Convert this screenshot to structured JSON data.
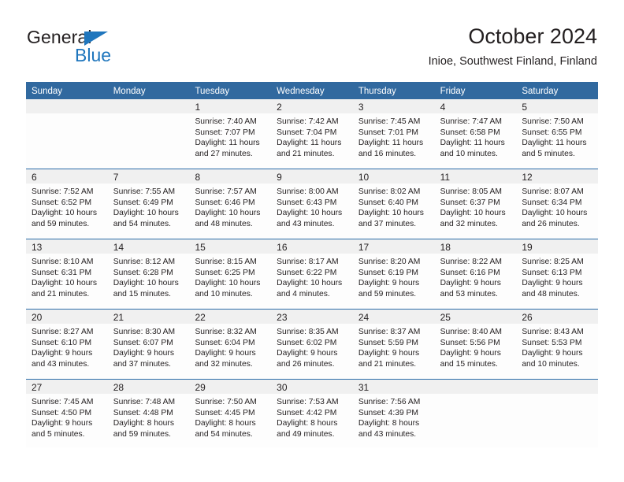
{
  "brand": {
    "name_part1": "General",
    "name_part2": "Blue",
    "triangle_icon": "blue-triangle-logo-mark",
    "color_dark": "#231f20",
    "color_blue": "#1f76bd"
  },
  "header": {
    "title": "October 2024",
    "subtitle": "Inioe, Southwest Finland, Finland"
  },
  "theme": {
    "header_row_bg": "#31699f",
    "header_row_text": "#ffffff",
    "day_band_bg": "#f0f0f0",
    "row_divider": "#2b6ca8",
    "cell_bg": "#fdfdfd",
    "text": "#231f20"
  },
  "weekdays": [
    "Sunday",
    "Monday",
    "Tuesday",
    "Wednesday",
    "Thursday",
    "Friday",
    "Saturday"
  ],
  "labels": {
    "sunrise_prefix": "Sunrise:",
    "sunset_prefix": "Sunset:",
    "daylight_prefix": "Daylight:"
  },
  "weeks": [
    [
      {
        "day": "",
        "empty": true,
        "sunrise": "",
        "sunset": "",
        "daylight_line1": "",
        "daylight_line2": ""
      },
      {
        "day": "",
        "empty": true,
        "sunrise": "",
        "sunset": "",
        "daylight_line1": "",
        "daylight_line2": ""
      },
      {
        "day": "1",
        "empty": false,
        "sunrise": "Sunrise: 7:40 AM",
        "sunset": "Sunset: 7:07 PM",
        "daylight_line1": "Daylight: 11 hours",
        "daylight_line2": "and 27 minutes."
      },
      {
        "day": "2",
        "empty": false,
        "sunrise": "Sunrise: 7:42 AM",
        "sunset": "Sunset: 7:04 PM",
        "daylight_line1": "Daylight: 11 hours",
        "daylight_line2": "and 21 minutes."
      },
      {
        "day": "3",
        "empty": false,
        "sunrise": "Sunrise: 7:45 AM",
        "sunset": "Sunset: 7:01 PM",
        "daylight_line1": "Daylight: 11 hours",
        "daylight_line2": "and 16 minutes."
      },
      {
        "day": "4",
        "empty": false,
        "sunrise": "Sunrise: 7:47 AM",
        "sunset": "Sunset: 6:58 PM",
        "daylight_line1": "Daylight: 11 hours",
        "daylight_line2": "and 10 minutes."
      },
      {
        "day": "5",
        "empty": false,
        "sunrise": "Sunrise: 7:50 AM",
        "sunset": "Sunset: 6:55 PM",
        "daylight_line1": "Daylight: 11 hours",
        "daylight_line2": "and 5 minutes."
      }
    ],
    [
      {
        "day": "6",
        "empty": false,
        "sunrise": "Sunrise: 7:52 AM",
        "sunset": "Sunset: 6:52 PM",
        "daylight_line1": "Daylight: 10 hours",
        "daylight_line2": "and 59 minutes."
      },
      {
        "day": "7",
        "empty": false,
        "sunrise": "Sunrise: 7:55 AM",
        "sunset": "Sunset: 6:49 PM",
        "daylight_line1": "Daylight: 10 hours",
        "daylight_line2": "and 54 minutes."
      },
      {
        "day": "8",
        "empty": false,
        "sunrise": "Sunrise: 7:57 AM",
        "sunset": "Sunset: 6:46 PM",
        "daylight_line1": "Daylight: 10 hours",
        "daylight_line2": "and 48 minutes."
      },
      {
        "day": "9",
        "empty": false,
        "sunrise": "Sunrise: 8:00 AM",
        "sunset": "Sunset: 6:43 PM",
        "daylight_line1": "Daylight: 10 hours",
        "daylight_line2": "and 43 minutes."
      },
      {
        "day": "10",
        "empty": false,
        "sunrise": "Sunrise: 8:02 AM",
        "sunset": "Sunset: 6:40 PM",
        "daylight_line1": "Daylight: 10 hours",
        "daylight_line2": "and 37 minutes."
      },
      {
        "day": "11",
        "empty": false,
        "sunrise": "Sunrise: 8:05 AM",
        "sunset": "Sunset: 6:37 PM",
        "daylight_line1": "Daylight: 10 hours",
        "daylight_line2": "and 32 minutes."
      },
      {
        "day": "12",
        "empty": false,
        "sunrise": "Sunrise: 8:07 AM",
        "sunset": "Sunset: 6:34 PM",
        "daylight_line1": "Daylight: 10 hours",
        "daylight_line2": "and 26 minutes."
      }
    ],
    [
      {
        "day": "13",
        "empty": false,
        "sunrise": "Sunrise: 8:10 AM",
        "sunset": "Sunset: 6:31 PM",
        "daylight_line1": "Daylight: 10 hours",
        "daylight_line2": "and 21 minutes."
      },
      {
        "day": "14",
        "empty": false,
        "sunrise": "Sunrise: 8:12 AM",
        "sunset": "Sunset: 6:28 PM",
        "daylight_line1": "Daylight: 10 hours",
        "daylight_line2": "and 15 minutes."
      },
      {
        "day": "15",
        "empty": false,
        "sunrise": "Sunrise: 8:15 AM",
        "sunset": "Sunset: 6:25 PM",
        "daylight_line1": "Daylight: 10 hours",
        "daylight_line2": "and 10 minutes."
      },
      {
        "day": "16",
        "empty": false,
        "sunrise": "Sunrise: 8:17 AM",
        "sunset": "Sunset: 6:22 PM",
        "daylight_line1": "Daylight: 10 hours",
        "daylight_line2": "and 4 minutes."
      },
      {
        "day": "17",
        "empty": false,
        "sunrise": "Sunrise: 8:20 AM",
        "sunset": "Sunset: 6:19 PM",
        "daylight_line1": "Daylight: 9 hours",
        "daylight_line2": "and 59 minutes."
      },
      {
        "day": "18",
        "empty": false,
        "sunrise": "Sunrise: 8:22 AM",
        "sunset": "Sunset: 6:16 PM",
        "daylight_line1": "Daylight: 9 hours",
        "daylight_line2": "and 53 minutes."
      },
      {
        "day": "19",
        "empty": false,
        "sunrise": "Sunrise: 8:25 AM",
        "sunset": "Sunset: 6:13 PM",
        "daylight_line1": "Daylight: 9 hours",
        "daylight_line2": "and 48 minutes."
      }
    ],
    [
      {
        "day": "20",
        "empty": false,
        "sunrise": "Sunrise: 8:27 AM",
        "sunset": "Sunset: 6:10 PM",
        "daylight_line1": "Daylight: 9 hours",
        "daylight_line2": "and 43 minutes."
      },
      {
        "day": "21",
        "empty": false,
        "sunrise": "Sunrise: 8:30 AM",
        "sunset": "Sunset: 6:07 PM",
        "daylight_line1": "Daylight: 9 hours",
        "daylight_line2": "and 37 minutes."
      },
      {
        "day": "22",
        "empty": false,
        "sunrise": "Sunrise: 8:32 AM",
        "sunset": "Sunset: 6:04 PM",
        "daylight_line1": "Daylight: 9 hours",
        "daylight_line2": "and 32 minutes."
      },
      {
        "day": "23",
        "empty": false,
        "sunrise": "Sunrise: 8:35 AM",
        "sunset": "Sunset: 6:02 PM",
        "daylight_line1": "Daylight: 9 hours",
        "daylight_line2": "and 26 minutes."
      },
      {
        "day": "24",
        "empty": false,
        "sunrise": "Sunrise: 8:37 AM",
        "sunset": "Sunset: 5:59 PM",
        "daylight_line1": "Daylight: 9 hours",
        "daylight_line2": "and 21 minutes."
      },
      {
        "day": "25",
        "empty": false,
        "sunrise": "Sunrise: 8:40 AM",
        "sunset": "Sunset: 5:56 PM",
        "daylight_line1": "Daylight: 9 hours",
        "daylight_line2": "and 15 minutes."
      },
      {
        "day": "26",
        "empty": false,
        "sunrise": "Sunrise: 8:43 AM",
        "sunset": "Sunset: 5:53 PM",
        "daylight_line1": "Daylight: 9 hours",
        "daylight_line2": "and 10 minutes."
      }
    ],
    [
      {
        "day": "27",
        "empty": false,
        "sunrise": "Sunrise: 7:45 AM",
        "sunset": "Sunset: 4:50 PM",
        "daylight_line1": "Daylight: 9 hours",
        "daylight_line2": "and 5 minutes."
      },
      {
        "day": "28",
        "empty": false,
        "sunrise": "Sunrise: 7:48 AM",
        "sunset": "Sunset: 4:48 PM",
        "daylight_line1": "Daylight: 8 hours",
        "daylight_line2": "and 59 minutes."
      },
      {
        "day": "29",
        "empty": false,
        "sunrise": "Sunrise: 7:50 AM",
        "sunset": "Sunset: 4:45 PM",
        "daylight_line1": "Daylight: 8 hours",
        "daylight_line2": "and 54 minutes."
      },
      {
        "day": "30",
        "empty": false,
        "sunrise": "Sunrise: 7:53 AM",
        "sunset": "Sunset: 4:42 PM",
        "daylight_line1": "Daylight: 8 hours",
        "daylight_line2": "and 49 minutes."
      },
      {
        "day": "31",
        "empty": false,
        "sunrise": "Sunrise: 7:56 AM",
        "sunset": "Sunset: 4:39 PM",
        "daylight_line1": "Daylight: 8 hours",
        "daylight_line2": "and 43 minutes."
      },
      {
        "day": "",
        "empty": true,
        "sunrise": "",
        "sunset": "",
        "daylight_line1": "",
        "daylight_line2": ""
      },
      {
        "day": "",
        "empty": true,
        "sunrise": "",
        "sunset": "",
        "daylight_line1": "",
        "daylight_line2": ""
      }
    ]
  ]
}
